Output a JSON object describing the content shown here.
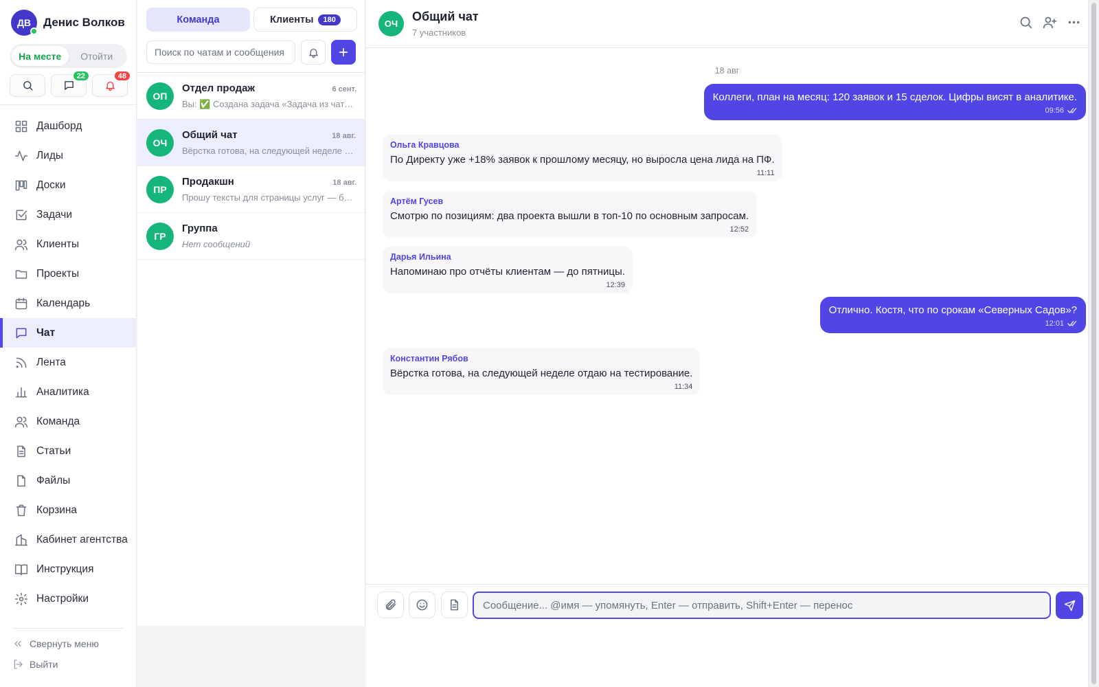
{
  "user": {
    "initials": "ДВ",
    "name": "Денис Волков",
    "status_active": "На месте",
    "status_away": "Отойти"
  },
  "quick": {
    "messages_badge": "22",
    "notifications_badge": "48"
  },
  "nav": [
    {
      "label": "Дашборд",
      "icon": "grid-icon"
    },
    {
      "label": "Лиды",
      "icon": "activity-icon"
    },
    {
      "label": "Доски",
      "icon": "kanban-icon"
    },
    {
      "label": "Задачи",
      "icon": "checkbox-icon"
    },
    {
      "label": "Клиенты",
      "icon": "users-icon"
    },
    {
      "label": "Проекты",
      "icon": "folder-icon"
    },
    {
      "label": "Календарь",
      "icon": "calendar-icon"
    },
    {
      "label": "Чат",
      "icon": "chat-icon",
      "active": true
    },
    {
      "label": "Лента",
      "icon": "rss-icon"
    },
    {
      "label": "Аналитика",
      "icon": "bar-chart-icon"
    },
    {
      "label": "Команда",
      "icon": "team-icon"
    },
    {
      "label": "Статьи",
      "icon": "article-icon"
    },
    {
      "label": "Файлы",
      "icon": "file-icon"
    },
    {
      "label": "Корзина",
      "icon": "trash-icon"
    },
    {
      "label": "Кабинет агентства",
      "icon": "building-icon"
    },
    {
      "label": "Инструкция",
      "icon": "book-icon"
    },
    {
      "label": "Настройки",
      "icon": "settings-icon"
    }
  ],
  "sidebar_bottom": {
    "collapse": "Свернуть меню",
    "logout": "Выйти"
  },
  "chatlist": {
    "tab_team": "Команда",
    "tab_clients": "Клиенты",
    "clients_count": "180",
    "search_placeholder": "Поиск по чатам и сообщения",
    "conversations": [
      {
        "initials": "ОП",
        "name": "Отдел продаж",
        "date": "6 сент.",
        "preview": "Вы: ✅ Создана задача «Задача из чата…"
      },
      {
        "initials": "ОЧ",
        "name": "Общий чат",
        "date": "18 авг.",
        "preview": "Вёрстка готова, на следующей неделе …",
        "active": true
      },
      {
        "initials": "ПР",
        "name": "Продакшн",
        "date": "18 авг.",
        "preview": "Прошу тексты для страницы услуг — бе…"
      },
      {
        "initials": "ГР",
        "name": "Группа",
        "date": "",
        "preview": "Нет сообщений",
        "empty": true
      }
    ]
  },
  "chat": {
    "initials": "ОЧ",
    "title": "Общий чат",
    "subtitle": "7 участников",
    "date_separator": "18 авг",
    "messages": [
      {
        "direction": "out",
        "text": "Коллеги, план на месяц: 120 заявок и 15 сделок. Цифры висят в аналитике.",
        "time": "09:56",
        "read": true
      },
      {
        "direction": "in",
        "author": "Ольга Кравцова",
        "text": "По Директу уже +18% заявок к прошлому месяцу, но выросла цена лида на ПФ.",
        "time": "11:11"
      },
      {
        "direction": "in",
        "author": "Артём Гусев",
        "text": "Смотрю по позициям: два проекта вышли в топ-10 по основным запросам.",
        "time": "12:52"
      },
      {
        "direction": "in",
        "author": "Дарья Ильина",
        "text": "Напоминаю про отчёты клиентам — до пятницы.",
        "time": "12:39"
      },
      {
        "direction": "out",
        "text": "Отлично. Костя, что по срокам «Северных Садов»?",
        "time": "12:01",
        "read": true
      },
      {
        "direction": "in",
        "author": "Константин Рябов",
        "text": "Вёрстка готова, на следующей неделе отдаю на тестирование.",
        "time": "11:34"
      }
    ],
    "composer_placeholder": "Сообщение... @имя — упомянуть, Enter — отправить, Shift+Enter — перенос"
  },
  "colors": {
    "accent": "#4f46e5",
    "avatar_green": "#16b57a",
    "online": "#22c55e",
    "badge_red": "#ef4444"
  }
}
